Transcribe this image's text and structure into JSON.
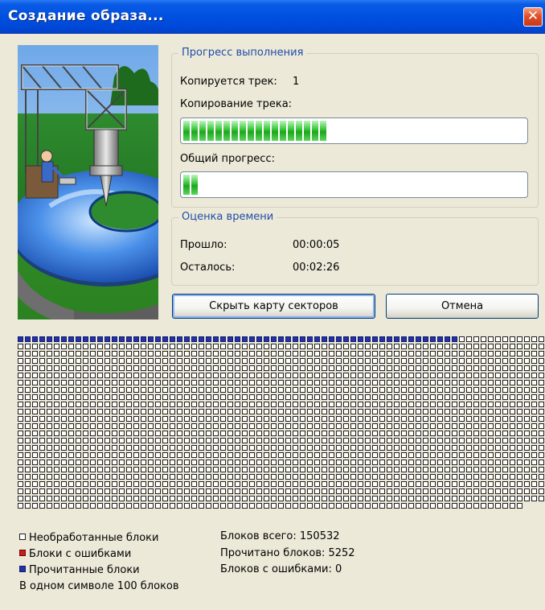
{
  "window": {
    "title": "Создание образа...",
    "close_label": "✕"
  },
  "progress_group": {
    "legend": "Прогресс выполнения",
    "current_track_label": "Копируется трек:",
    "current_track_value": "1",
    "track_copy_label": "Копирование трека:",
    "track_progress": 0.43,
    "total_label": "Общий прогресс:",
    "total_progress": 0.05
  },
  "time_group": {
    "legend": "Оценка времени",
    "elapsed_label": "Прошло:",
    "elapsed_value": "00:00:05",
    "remaining_label": "Осталось:",
    "remaining_value": "00:02:26"
  },
  "buttons": {
    "hide_map": "Скрыть карту секторов",
    "cancel": "Отмена"
  },
  "sector_map": {
    "columns": 76,
    "rows": 24,
    "total_cells": 1818,
    "read_cells": 61,
    "error_cells": 0
  },
  "legend": {
    "unprocessed": "Необработанные блоки",
    "errors": "Блоки с ошибками",
    "read": "Прочитанные блоки",
    "scale_note": "В одном символе 100 блоков"
  },
  "stats": {
    "total_blocks": "Блоков всего: 150532",
    "read_blocks": "Прочитано блоков: 5252",
    "error_blocks": "Блоков с ошибками: 0"
  },
  "colors": {
    "titlebar": "#0050E0",
    "progress_fill": "#34C434",
    "read_block": "#2233A8",
    "error_block": "#C81E1E",
    "unprocessed_block": "#FFFFFF",
    "group_legend_text": "#1F4DA8"
  }
}
